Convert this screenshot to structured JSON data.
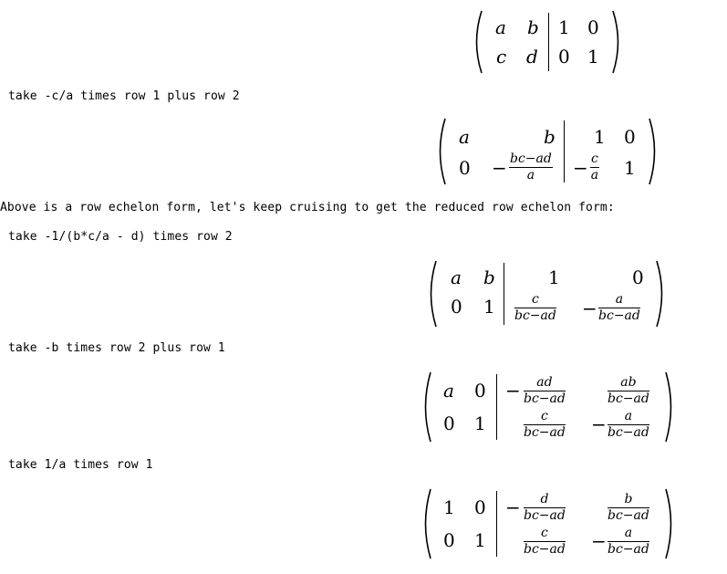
{
  "steps": {
    "step1": "take -c/a times row 1 plus row 2",
    "note": "Above is a row echelon form, let's keep cruising to get the reduced row echelon form:",
    "step2": "take -1/(b*c/a - d) times row 2",
    "step3": "take -b times row 2 plus row 1",
    "step4": "take 1/a times row 1"
  },
  "matrix0": {
    "r1": [
      "a",
      "b",
      "1",
      "0"
    ],
    "r2": [
      "c",
      "d",
      "0",
      "1"
    ]
  },
  "matrix1": {
    "r1": [
      "a",
      "b",
      "1",
      "0"
    ],
    "r2_a": "0",
    "r2_sign": "−",
    "r2_b": {
      "num": "bc−ad",
      "den": "a"
    },
    "r2_c_sign": "−",
    "r2_c": {
      "num": "c",
      "den": "a"
    },
    "r2_d": "1"
  },
  "matrix2": {
    "r1": [
      "a",
      "b",
      "1",
      "0"
    ],
    "r2_a": "0",
    "r2_b": "1",
    "r2_c": {
      "num": "c",
      "den": "bc−ad"
    },
    "r2_d_sign": "−",
    "r2_d": {
      "num": "a",
      "den": "bc−ad"
    }
  },
  "matrix3": {
    "r1_a": "a",
    "r1_b": "0",
    "r1_c_sign": "−",
    "r1_c": {
      "num": "ad",
      "den": "bc−ad"
    },
    "r1_d": {
      "num": "ab",
      "den": "bc−ad"
    },
    "r2_a": "0",
    "r2_b": "1",
    "r2_c": {
      "num": "c",
      "den": "bc−ad"
    },
    "r2_d_sign": "−",
    "r2_d": {
      "num": "a",
      "den": "bc−ad"
    }
  },
  "matrix4": {
    "r1_a": "1",
    "r1_b": "0",
    "r1_c_sign": "−",
    "r1_c": {
      "num": "d",
      "den": "bc−ad"
    },
    "r1_d": {
      "num": "b",
      "den": "bc−ad"
    },
    "r2_a": "0",
    "r2_b": "1",
    "r2_c": {
      "num": "c",
      "den": "bc−ad"
    },
    "r2_d_sign": "−",
    "r2_d": {
      "num": "a",
      "den": "bc−ad"
    }
  }
}
